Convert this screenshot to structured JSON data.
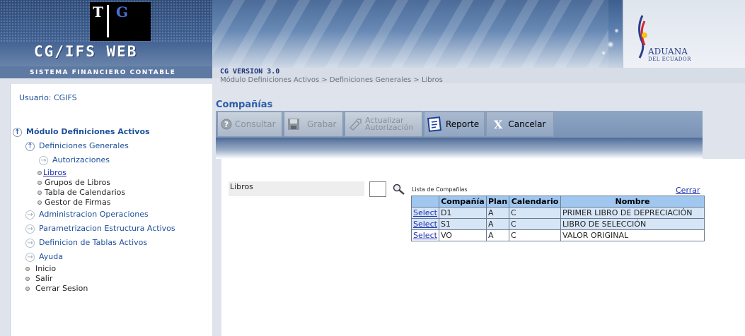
{
  "header": {
    "logo_letters": [
      "T",
      "G"
    ],
    "app_title": "CG/IFS WEB",
    "app_subtitle": "SISTEMA FINANCIERO CONTABLE",
    "version": "CG VERSION 3.0",
    "breadcrumb": "Módulo Definiciones Activos > Definiciones Generales > Libros",
    "org_name": "ADUANA",
    "org_subtitle": "DEL ECUADOR"
  },
  "sidebar": {
    "user": "Usuario: CGIFS",
    "module": "Módulo Definiciones Activos",
    "items": [
      {
        "label": "Definiciones Generales"
      },
      {
        "label": "Autorizaciones"
      },
      {
        "label": "Libros"
      },
      {
        "label": "Grupos de Libros"
      },
      {
        "label": "Tabla de Calendarios"
      },
      {
        "label": "Gestor de Firmas"
      },
      {
        "label": "Administracion Operaciones"
      },
      {
        "label": "Parametrizacion Estructura Activos"
      },
      {
        "label": "Definicion de Tablas Activos"
      },
      {
        "label": "Ayuda"
      },
      {
        "label": "Inicio"
      },
      {
        "label": "Salir"
      },
      {
        "label": "Cerrar Sesion"
      }
    ]
  },
  "main": {
    "title": "Compañías",
    "toolbar": {
      "consultar": "Consultar",
      "grabar": "Grabar",
      "actualizar_1": "Actualizar",
      "actualizar_2": "Autorización",
      "reporte": "Reporte",
      "cancelar": "Cancelar"
    },
    "form": {
      "libros_label": "Libros",
      "libros_value": ""
    },
    "lookup": {
      "title": "Lista de Compañías",
      "close": "Cerrar",
      "columns": [
        "",
        "Compañía",
        "Plan",
        "Calendario",
        "Nombre"
      ],
      "rows": [
        {
          "select": "Select",
          "compania": "D1",
          "plan": "A",
          "calendario": "C",
          "nombre": "PRIMER LIBRO DE DEPRECIACIÓN"
        },
        {
          "select": "Select",
          "compania": "S1",
          "plan": "A",
          "calendario": "C",
          "nombre": "LIBRO DE SELECCIÓN"
        },
        {
          "select": "Select",
          "compania": "VO",
          "plan": "A",
          "calendario": "C",
          "nombre": "VALOR ORIGINAL"
        }
      ]
    }
  },
  "colors": {
    "accent": "#2b5ca8",
    "table_header": "#9fc7f0",
    "table_alt_row": "#d7e6f6",
    "link": "#1c2fb0"
  },
  "icons": {
    "consultar": "question-icon",
    "grabar": "save-icon",
    "actualizar": "update-icon",
    "reporte": "report-icon",
    "cancelar": "close-icon",
    "search": "magnifier-icon"
  }
}
